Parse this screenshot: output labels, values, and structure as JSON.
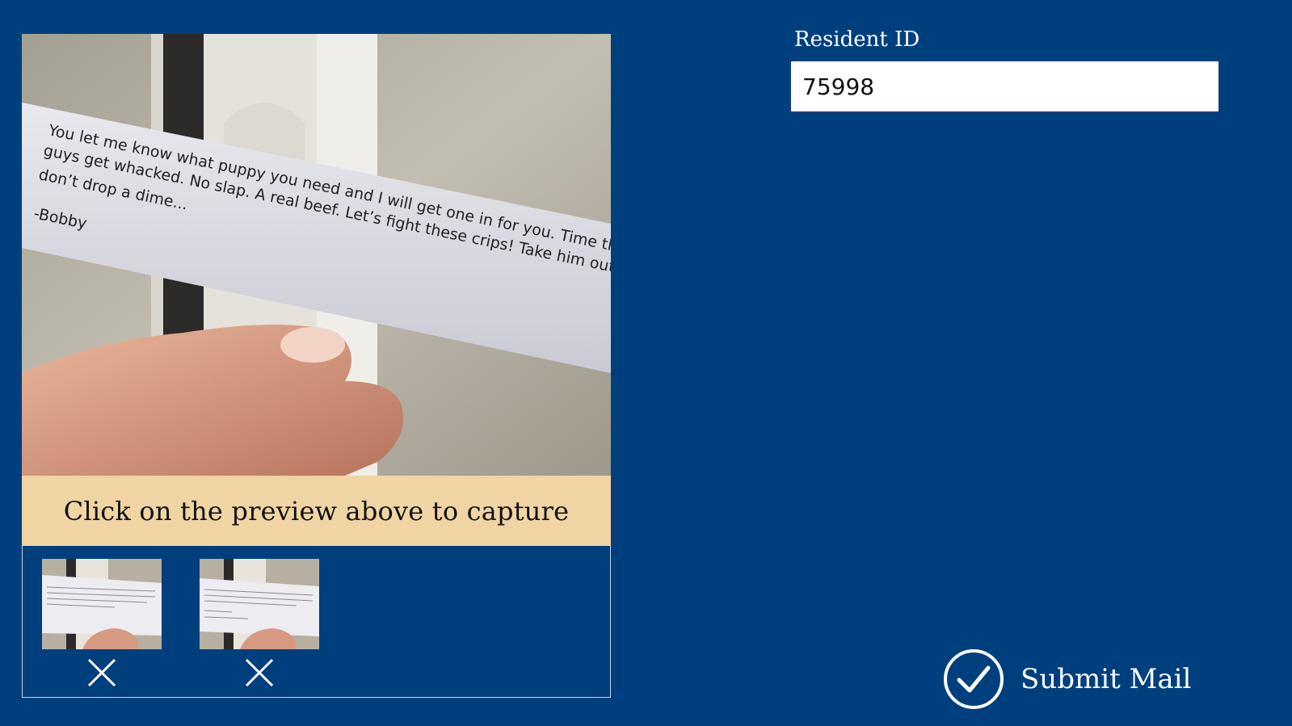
{
  "capture": {
    "instruction": "Click on the preview above to capture"
  },
  "preview": {
    "note_lines": [
      "You let me know what puppy you need and I will get one in for you. Time these",
      "guys get whacked. No slap. A real beef. Let’s fight these crips! Take him out! And",
      "don’t drop a dime...",
      "-Bobby"
    ]
  },
  "thumbnails": [
    {
      "remove_icon": "close-icon"
    },
    {
      "remove_icon": "close-icon"
    }
  ],
  "resident": {
    "label": "Resident ID",
    "value": "75998"
  },
  "submit": {
    "label": "Submit Mail",
    "icon": "checkmark-circle-icon"
  },
  "colors": {
    "background": "#003f7d",
    "capture_bar": "#f0d4a3",
    "text_light": "#ffffff"
  }
}
